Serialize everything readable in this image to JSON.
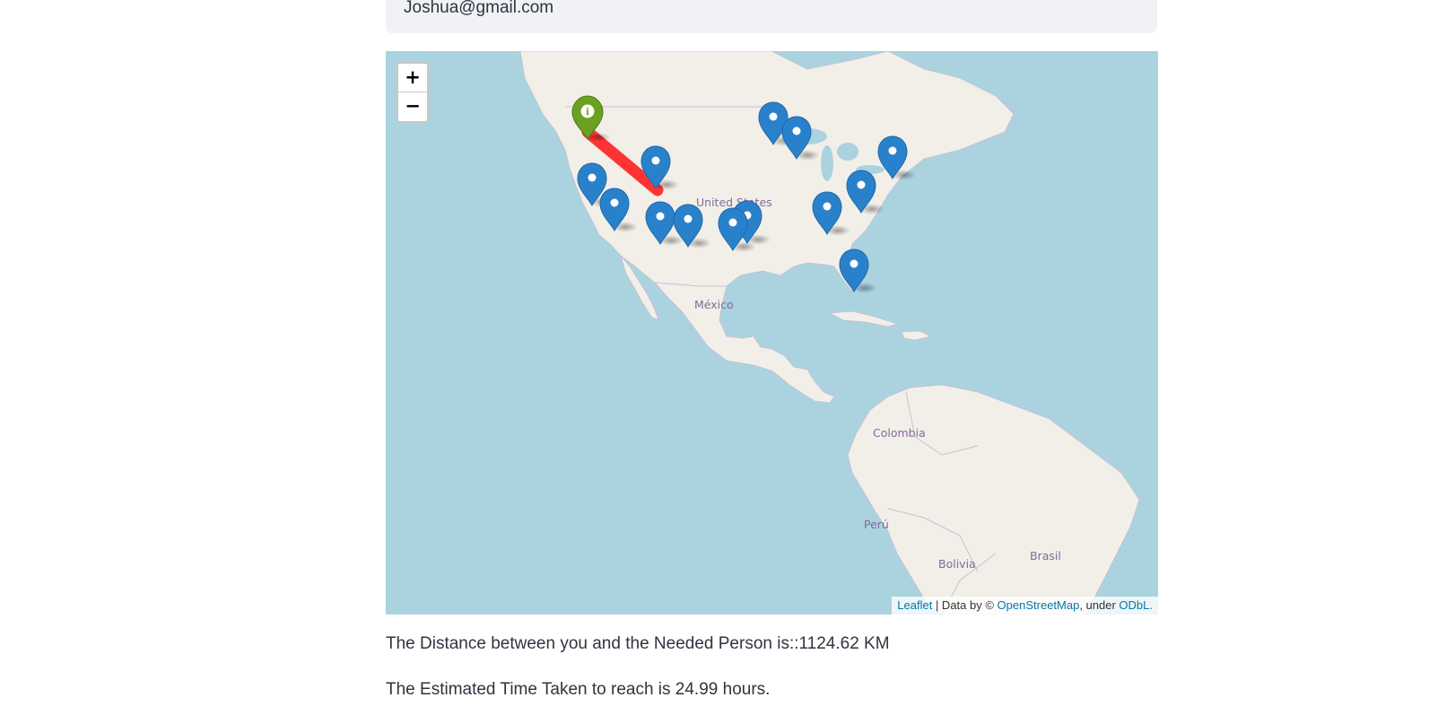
{
  "email": {
    "value": "Joshua@gmail.com"
  },
  "map": {
    "zoom_in_label": "+",
    "zoom_out_label": "−",
    "labels": {
      "usa": "United States",
      "mexico": "México",
      "colombia": "Colombia",
      "peru": "Perú",
      "bolivia": "Bolivia",
      "brasil": "Brasil"
    },
    "attribution": {
      "leaflet": "Leaflet",
      "data_by": " | Data by © ",
      "osm": "OpenStreetMap",
      "under": ", under ",
      "odbl": "ODbL."
    },
    "colors": {
      "water": "#aad3df",
      "land": "#f2efe9",
      "route": "#ff3333",
      "marker_blue": "#2a81cb",
      "marker_green": "#6aa121"
    },
    "current_location_marker_icon": "info-icon",
    "marker_icon": "location-pin-icon"
  },
  "results": {
    "distance": "The Distance between you and the Needed Person is::1124.62 KM",
    "time": "The Estimated Time Taken to reach is 24.99 hours."
  }
}
